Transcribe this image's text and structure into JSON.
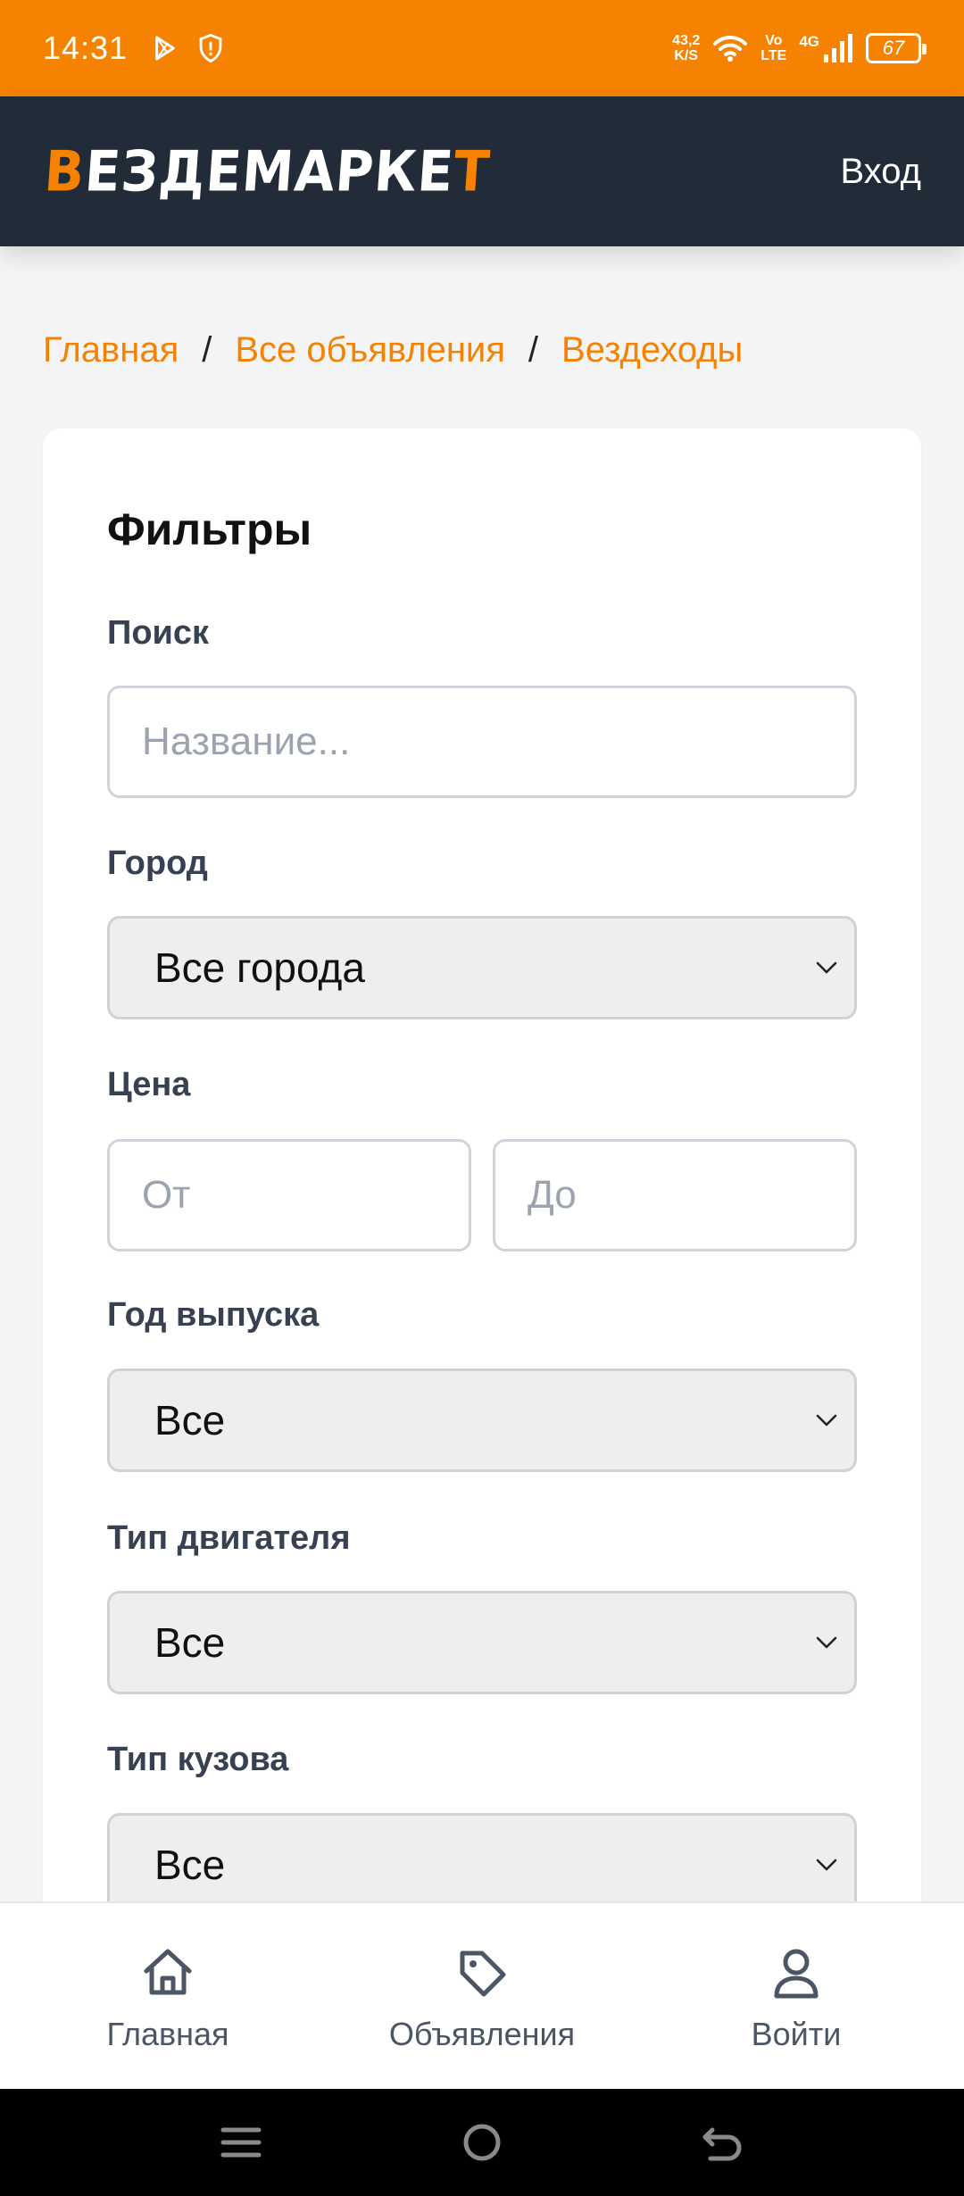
{
  "status_bar": {
    "time": "14:31",
    "net_speed_value": "43,2",
    "net_speed_unit": "K/S",
    "volte_top": "Vo",
    "volte_bottom": "LTE",
    "network": "4G",
    "battery": "67",
    "icons": [
      "play-store-icon",
      "shield-icon",
      "wifi-icon",
      "signal-icon",
      "battery-icon"
    ]
  },
  "header": {
    "logo_first": "В",
    "logo_middle": "ЕЗДЕМАРКЕ",
    "logo_last": "Т",
    "login_label": "Вход",
    "background": "#222b38",
    "accent": "#f58200"
  },
  "breadcrumb": {
    "items": [
      "Главная",
      "Все объявления",
      "Вездеходы"
    ],
    "separator": "/"
  },
  "filters": {
    "title": "Фильтры",
    "search": {
      "label": "Поиск",
      "placeholder": "Название...",
      "value": ""
    },
    "city": {
      "label": "Город",
      "selected": "Все города"
    },
    "price": {
      "label": "Цена",
      "from_placeholder": "От",
      "to_placeholder": "До"
    },
    "year": {
      "label": "Год выпуска",
      "selected": "Все"
    },
    "engine": {
      "label": "Тип двигателя",
      "selected": "Все"
    },
    "body": {
      "label": "Тип кузова",
      "selected": "Все"
    }
  },
  "bottom_nav": {
    "items": [
      {
        "label": "Главная",
        "icon": "home-icon"
      },
      {
        "label": "Объявления",
        "icon": "tag-icon"
      },
      {
        "label": "Войти",
        "icon": "user-icon"
      }
    ]
  },
  "system_nav": {
    "icons": [
      "menu-icon",
      "home-circle-icon",
      "back-icon"
    ]
  }
}
